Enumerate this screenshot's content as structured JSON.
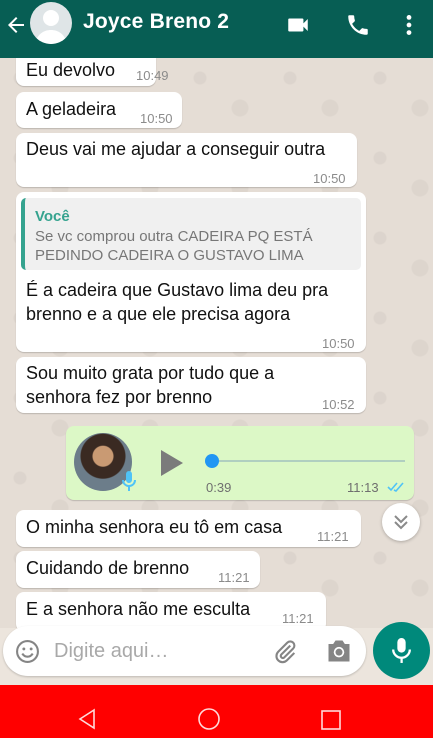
{
  "header": {
    "title": "Joyce Breno 2",
    "icons": [
      "back-arrow-icon",
      "avatar-icon",
      "video-call-icon",
      "phone-icon",
      "more-vert-icon"
    ]
  },
  "messages": [
    {
      "text": "Eu devolvo",
      "time": "10:49"
    },
    {
      "text": "A geladeira",
      "time": "10:50"
    },
    {
      "text": "Deus vai me ajudar a conseguir outra",
      "time": "10:50"
    },
    {
      "quote_author": "Você",
      "quote_text": "Se vc comprou outra CADEIRA PQ ESTÁ PEDINDO CADEIRA O GUSTAVO LIMA",
      "text": "É a cadeira que Gustavo lima deu pra brenno e a que ele precisa agora",
      "time": "10:50"
    },
    {
      "text": "Sou muito grata por tudo que a senhora fez por brenno",
      "time": "10:52"
    },
    {
      "text": "O minha senhora eu tô em casa",
      "time": "11:21"
    },
    {
      "text": "Cuidando de brenno",
      "time": "11:21"
    },
    {
      "text": "E a senhora não me esculta",
      "time": "11:21"
    }
  ],
  "voice": {
    "duration": "0:39",
    "time": "11:13",
    "progress": 0.0
  },
  "input": {
    "placeholder": "Digite aqui…"
  },
  "colors": {
    "header": "#075e54",
    "outgoing": "#dcf8c6",
    "accent": "#00897b",
    "navbar": "#ff0000",
    "ticks": "#4fc3f7"
  }
}
